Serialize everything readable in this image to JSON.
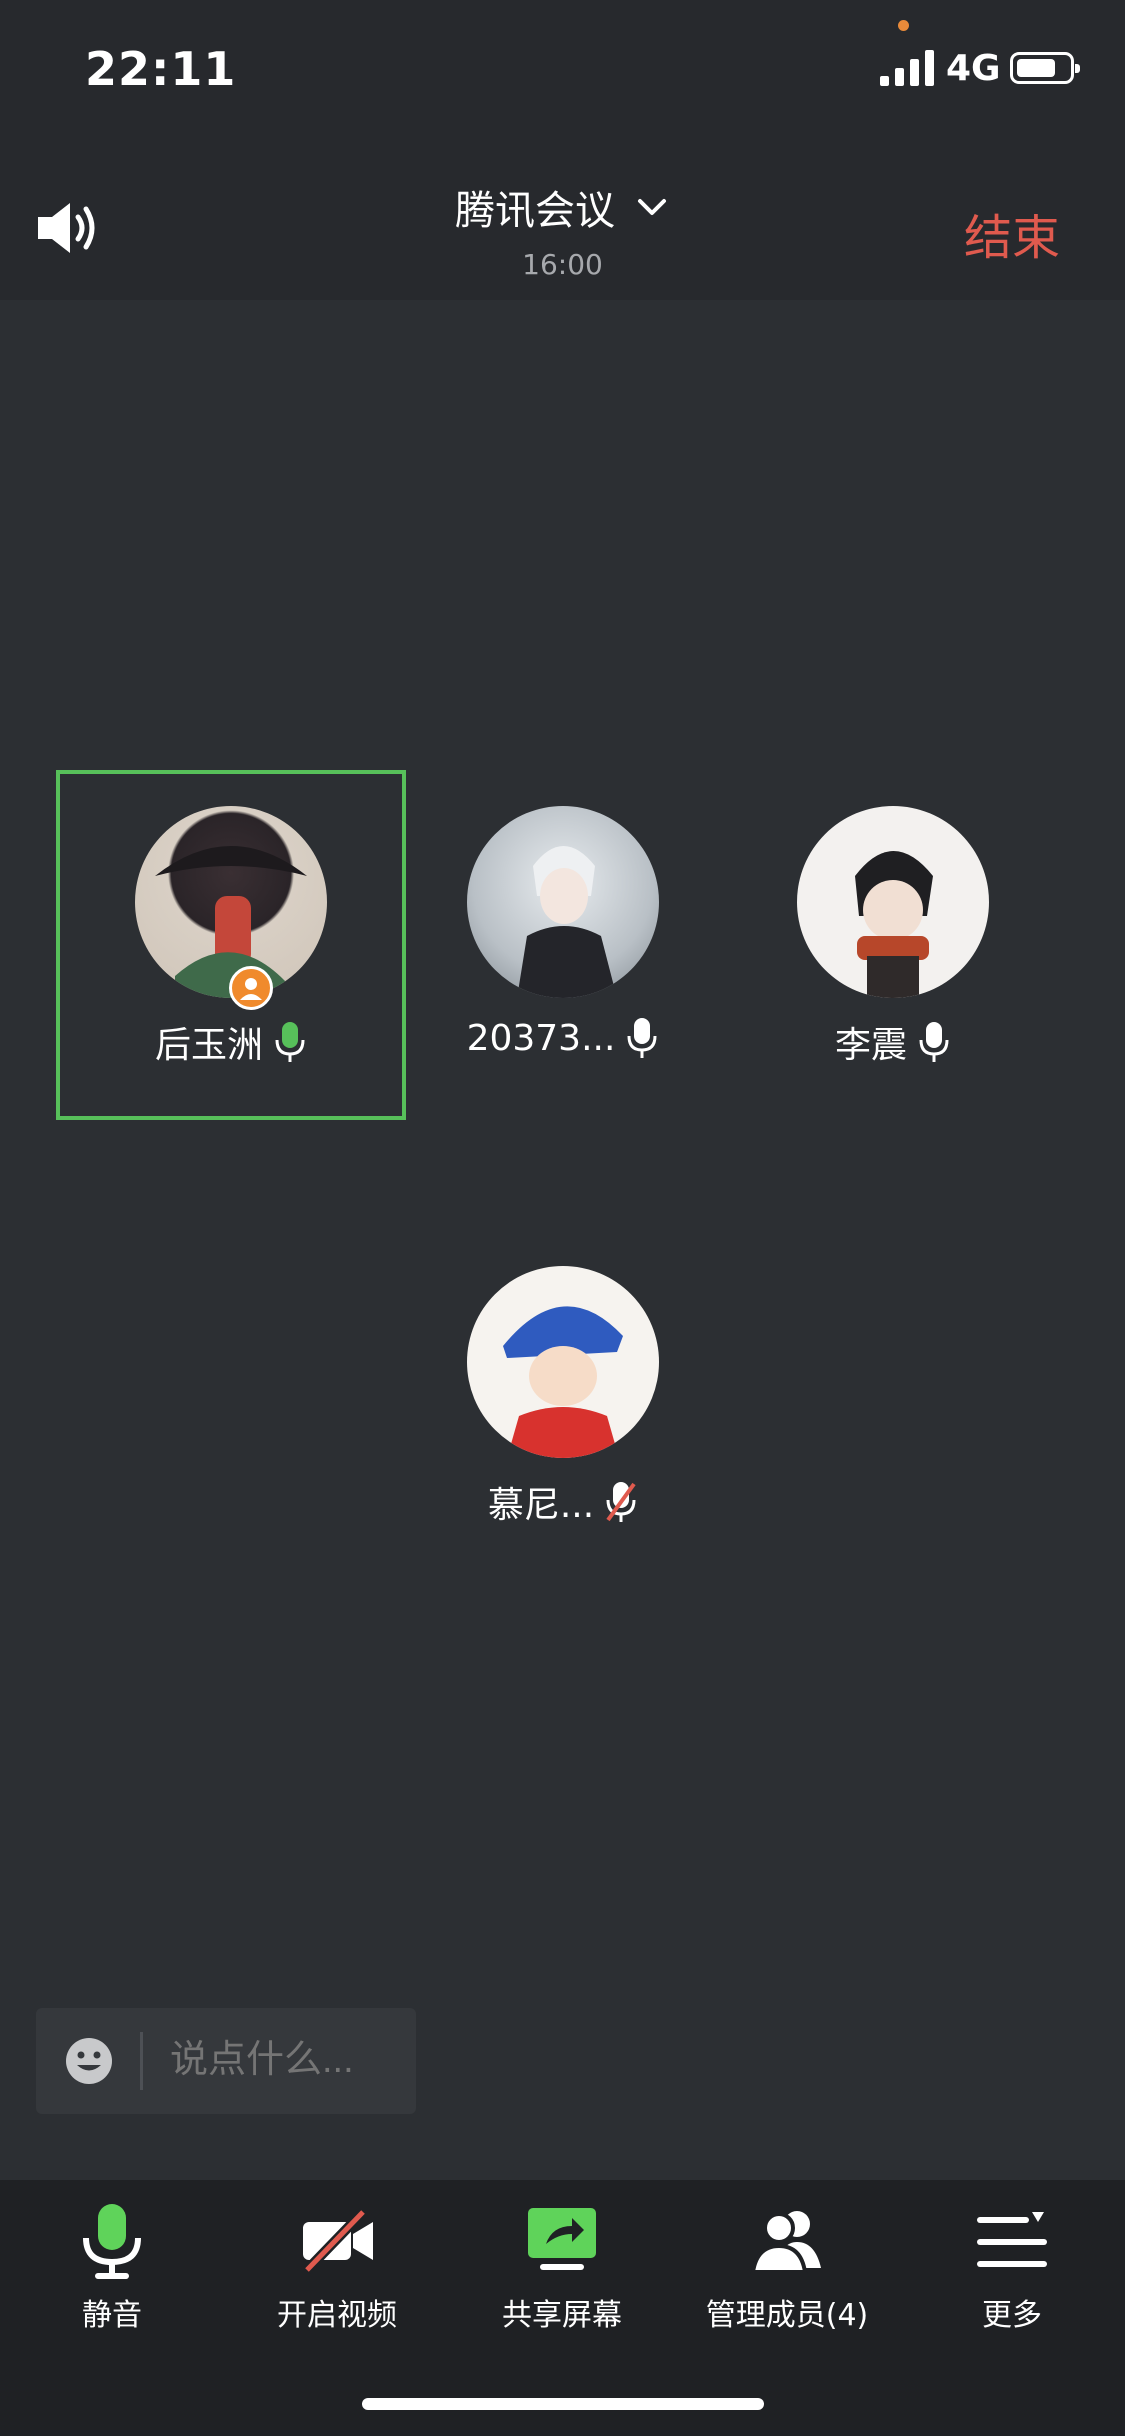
{
  "status_bar": {
    "time": "22:11",
    "network": "4G"
  },
  "header": {
    "title": "腾讯会议",
    "subtitle": "16:00",
    "end_label": "结束"
  },
  "participants": [
    {
      "name": "后玉洲",
      "mic": "active",
      "host": true
    },
    {
      "name": "20373...",
      "mic": "on"
    },
    {
      "name": "李震",
      "mic": "on"
    },
    {
      "name": "慕尼...",
      "mic": "muted"
    }
  ],
  "chat": {
    "placeholder": "说点什么..."
  },
  "toolbar": {
    "items": [
      {
        "label": "静音",
        "icon": "mic-icon"
      },
      {
        "label": "开启视频",
        "icon": "video-off-icon"
      },
      {
        "label": "共享屏幕",
        "icon": "share-screen-icon"
      },
      {
        "label": "管理成员(4)",
        "icon": "members-icon"
      },
      {
        "label": "更多",
        "icon": "more-icon"
      }
    ]
  },
  "colors": {
    "accent_green": "#57c05a",
    "end_red": "#e05a4e",
    "host_orange": "#f08a2c",
    "background": "#2c2f33"
  }
}
